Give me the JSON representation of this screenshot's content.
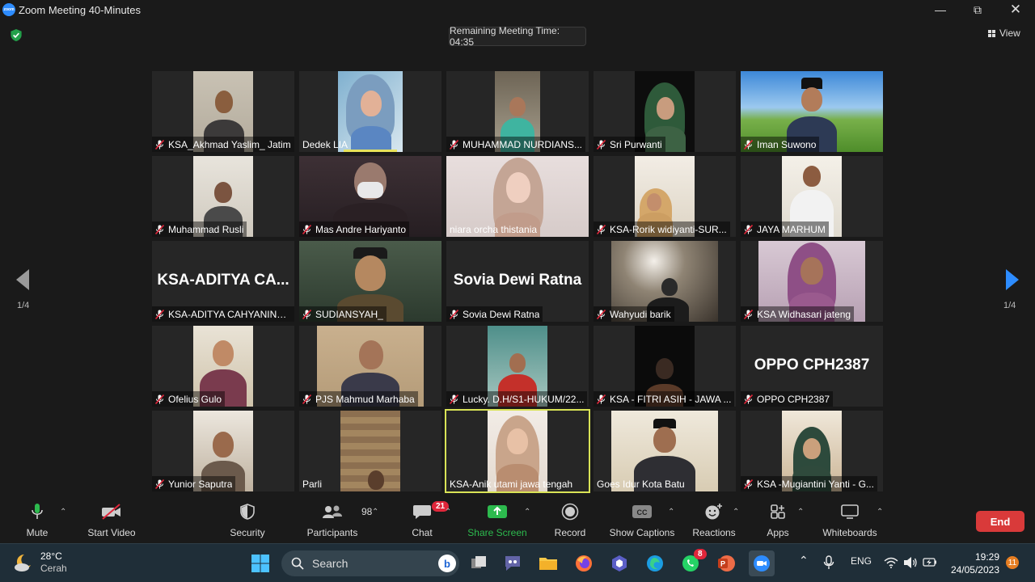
{
  "window": {
    "title": "Zoom Meeting 40-Minutes",
    "logo_text": "zoom"
  },
  "top": {
    "timer": "Remaining Meeting Time: 04:35",
    "view_label": "View"
  },
  "pagination": {
    "left_label": "1/4",
    "right_label": "1/4"
  },
  "participants_grid": [
    {
      "name": "KSA_Akhmad Yaslim_ Jatim",
      "muted": true
    },
    {
      "name": "Dedek LIA",
      "muted": false
    },
    {
      "name": "MUHAMMAD NURDIANS...",
      "muted": true
    },
    {
      "name": "Sri Purwanti",
      "muted": true
    },
    {
      "name": "Iman Suwono",
      "muted": true
    },
    {
      "name": "Muhammad Rusli",
      "muted": true
    },
    {
      "name": "Mas Andre Hariyanto",
      "muted": true
    },
    {
      "name": "niara orcha thistania",
      "muted": false
    },
    {
      "name": "KSA-Rorik widiyanti-SUR...",
      "muted": true
    },
    {
      "name": "JAYA MARHUM",
      "muted": true
    },
    {
      "name": "KSA-ADITYA CAHYANING...",
      "muted": true,
      "avatar_text": "KSA-ADITYA  CA..."
    },
    {
      "name": "SUDIANSYAH_",
      "muted": true
    },
    {
      "name": "Sovia Dewi Ratna",
      "muted": true,
      "avatar_text": "Sovia Dewi Ratna"
    },
    {
      "name": "Wahyudi barik",
      "muted": true
    },
    {
      "name": "KSA Widhasari jateng",
      "muted": true
    },
    {
      "name": "Ofelius Gulo",
      "muted": true
    },
    {
      "name": "PJS Mahmud Marhaba",
      "muted": true
    },
    {
      "name": "Lucky. D.H/S1-HUKUM/22...",
      "muted": true
    },
    {
      "name": "KSA - FITRI ASIH - JAWA ...",
      "muted": true
    },
    {
      "name": "OPPO CPH2387",
      "muted": true,
      "avatar_text": "OPPO CPH2387"
    },
    {
      "name": "Yunior Saputra",
      "muted": true
    },
    {
      "name": "Parli",
      "muted": false
    },
    {
      "name": "KSA-Anik utami jawa tengah",
      "muted": false,
      "active_speaker": true
    },
    {
      "name": "Goes Idur Kota Batu",
      "muted": false
    },
    {
      "name": "KSA -Mugiantini Yanti - G...",
      "muted": true
    }
  ],
  "toolbar": {
    "mute": "Mute",
    "start_video": "Start Video",
    "security": "Security",
    "participants": "Participants",
    "participants_count": "98",
    "chat": "Chat",
    "chat_badge": "21",
    "share_screen": "Share Screen",
    "record": "Record",
    "show_captions": "Show Captions",
    "cc": "CC",
    "reactions": "Reactions",
    "apps": "Apps",
    "whiteboards": "Whiteboards",
    "end": "End"
  },
  "taskbar": {
    "temperature": "28°C",
    "weather_desc": "Cerah",
    "search_placeholder": "Search",
    "whatsapp_badge": "8",
    "language": "ENG",
    "time": "19:29",
    "date": "24/05/2023",
    "notification_count": "11"
  },
  "colors": {
    "accent_zoom_blue": "#2D8CFF",
    "share_green": "#2dba4e",
    "end_red": "#d93a3a",
    "active_speaker": "#d9e356",
    "mute_red": "#e0263a"
  }
}
